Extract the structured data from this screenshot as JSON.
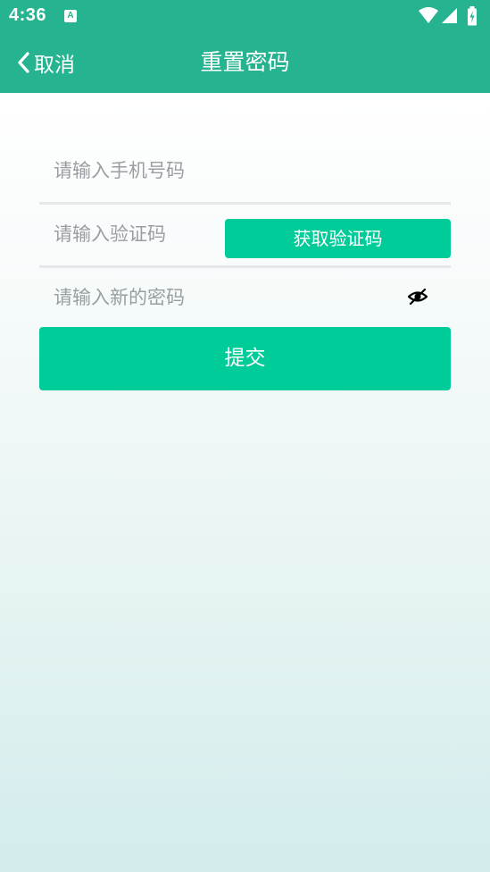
{
  "status_bar": {
    "time": "4:36",
    "notification_icon": "a-icon",
    "icons": [
      "wifi-icon",
      "signal-icon",
      "battery-icon"
    ]
  },
  "nav": {
    "back_label": "取消",
    "title": "重置密码"
  },
  "form": {
    "phone_placeholder": "请输入手机号码",
    "code_placeholder": "请输入验证码",
    "get_code_label": "获取验证码",
    "password_placeholder": "请输入新的密码",
    "password_visibility_icon": "eye-off-icon",
    "submit_label": "提交"
  },
  "colors": {
    "header_bg": "#26b38f",
    "accent": "#00cc99",
    "divider": "#e6e8e9",
    "placeholder": "#9a9ea2"
  }
}
